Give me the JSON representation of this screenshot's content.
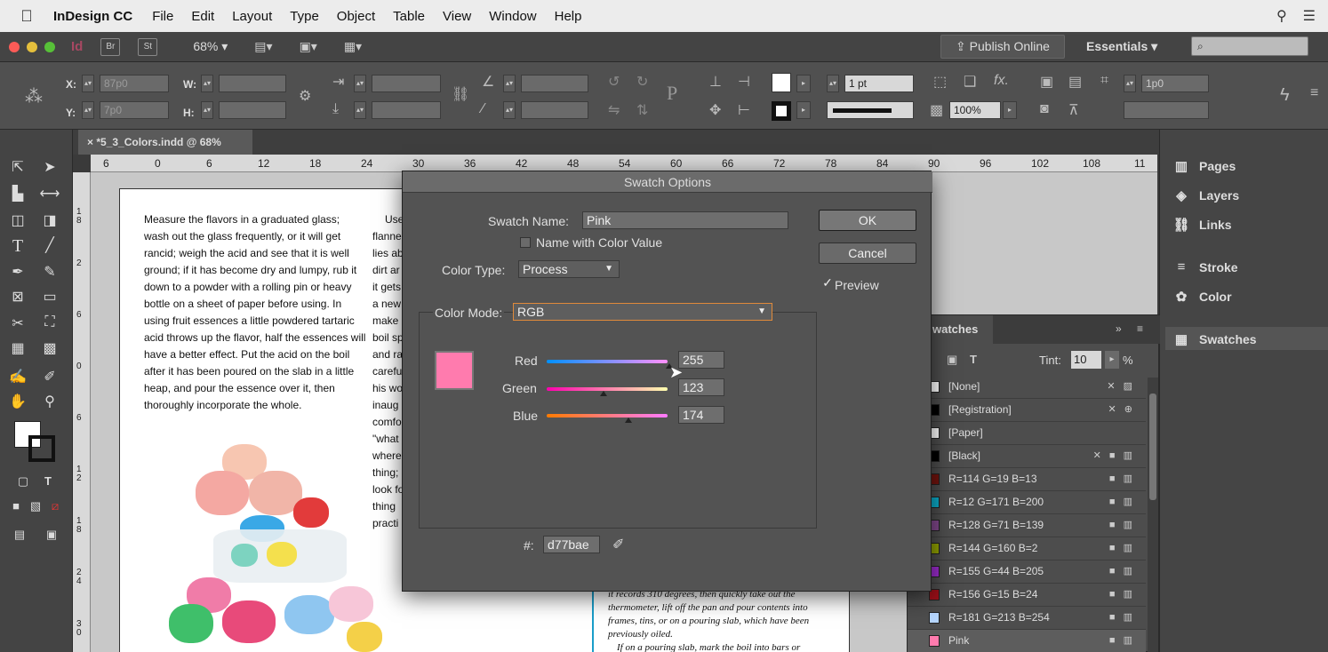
{
  "menubar": {
    "app": "InDesign CC",
    "items": [
      "File",
      "Edit",
      "Layout",
      "Type",
      "Object",
      "Table",
      "View",
      "Window",
      "Help"
    ]
  },
  "appbar": {
    "zoom": "68%",
    "br": "Br",
    "st": "St",
    "publish": "Publish Online",
    "workspace": "Essentials"
  },
  "control": {
    "x_label": "X:",
    "y_label": "Y:",
    "w_label": "W:",
    "h_label": "H:",
    "x_value": "87p0",
    "y_value": "7p0",
    "stroke_weight": "1 pt",
    "scale": "100%",
    "offset": "1p0"
  },
  "document": {
    "tab": "*5_3_Colors.indd @ 68%",
    "ruler_marks": [
      "6",
      "0",
      "6",
      "12",
      "18",
      "24",
      "30",
      "36",
      "42",
      "48",
      "54",
      "60",
      "66",
      "72",
      "78",
      "84",
      "90",
      "96",
      "102",
      "108",
      "11"
    ],
    "v_ruler_marks": [
      "1\n8",
      "2",
      "6",
      "0",
      "6",
      "1\n2",
      "1\n8",
      "2\n4",
      "3\n0"
    ],
    "body_text": "Measure the flavors in a graduated glass; wash out the glass frequently, or it will get rancid; weigh the acid and see that it is well ground; if it has become dry and lumpy, rub it down to a powder with a rolling pin or heavy bottle on a sheet of paper before using. In using fruit essences a little powdered tartaric acid throws up the flavor, half the essences will have a better effect. Put the acid on the boil after it has been poured on the slab in a little heap, and pour the essence over it, then thoroughly incorporate the whole.",
    "col2_lines": [
      "Use",
      "flanne",
      "lies ab",
      "dirt ar",
      "it gets",
      "a new",
      "make",
      "boil sp",
      "and ra",
      "carefu",
      "his wo",
      "inaug",
      "comfo",
      "\"what",
      "where",
      "thing;",
      "look fo",
      "thing",
      "practi"
    ],
    "sidebar_text": "it records 310 degrees, then quickly take out the thermometer, lift off the pan and pour contents into frames, tins, or on a pouring slab, which have been previously oiled.",
    "sidebar_text2": "If on a pouring slab, mark the boil into bars or"
  },
  "dock": {
    "items": [
      "Pages",
      "Layers",
      "Links",
      "Stroke",
      "Color",
      "Swatches"
    ]
  },
  "swatches": {
    "title": "watches",
    "tint_label": "Tint:",
    "tint_value": "10",
    "tint_unit": "%",
    "rows": [
      {
        "name": "[None]",
        "color": "#ffffff",
        "marks": "✕ ▨"
      },
      {
        "name": "[Registration]",
        "color": "#000000",
        "marks": "✕ ⊕"
      },
      {
        "name": "[Paper]",
        "color": "#ffffff",
        "marks": ""
      },
      {
        "name": "[Black]",
        "color": "#000000",
        "marks": "✕ ■ ▥"
      },
      {
        "name": "R=114 G=19 B=13",
        "color": "#72130d",
        "marks": "■ ▥"
      },
      {
        "name": "R=12 G=171 B=200",
        "color": "#0cabc8",
        "marks": "■ ▥"
      },
      {
        "name": "R=128 G=71 B=139",
        "color": "#80478b",
        "marks": "■ ▥"
      },
      {
        "name": "R=144 G=160 B=2",
        "color": "#90a002",
        "marks": "■ ▥"
      },
      {
        "name": "R=155 G=44 B=205",
        "color": "#9b2ccd",
        "marks": "■ ▥"
      },
      {
        "name": "R=156 G=15 B=24",
        "color": "#9c0f18",
        "marks": "■ ▥"
      },
      {
        "name": "R=181 G=213 B=254",
        "color": "#b5d5fe",
        "marks": "■ ▥"
      },
      {
        "name": "Pink",
        "color": "#ff7bae",
        "marks": "■ ▥"
      }
    ]
  },
  "dialog": {
    "title": "Swatch Options",
    "swatch_name_label": "Swatch Name:",
    "swatch_name": "Pink",
    "name_with_color_value": "Name with Color Value",
    "color_type_label": "Color Type:",
    "color_type": "Process",
    "color_mode_label": "Color Mode:",
    "color_mode": "RGB",
    "ok": "OK",
    "cancel": "Cancel",
    "preview": "Preview",
    "preview_checked": true,
    "red_label": "Red",
    "red": "255",
    "green_label": "Green",
    "green": "123",
    "blue_label": "Blue",
    "blue": "174",
    "hex_label": "#:",
    "hex": "d77bae",
    "swatch_color": "#ff7bae"
  }
}
